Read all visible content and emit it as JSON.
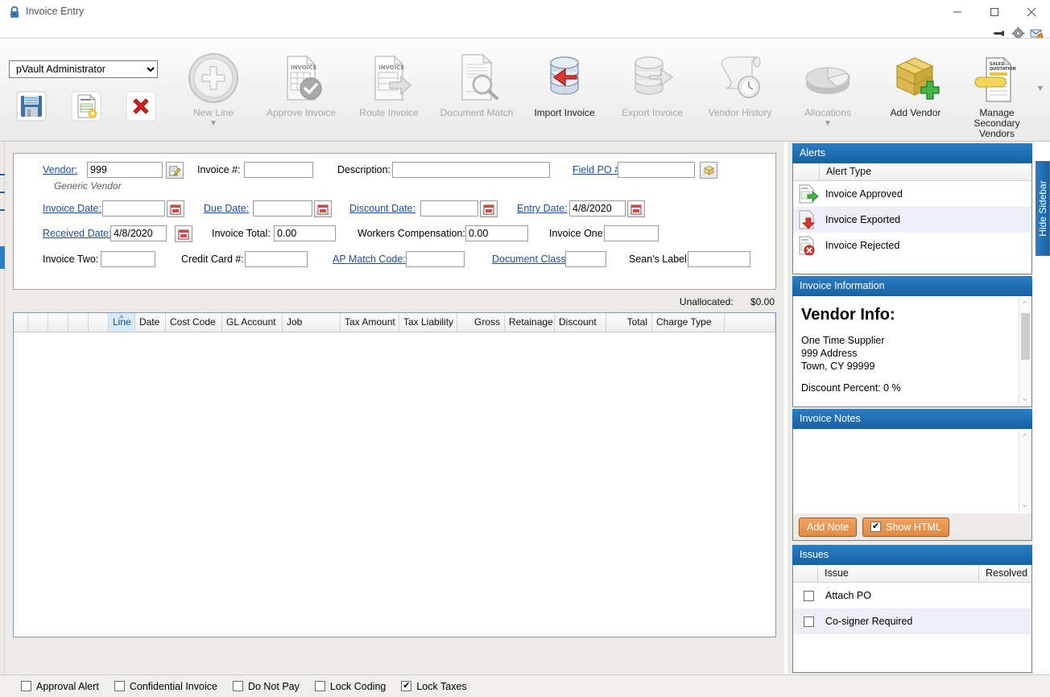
{
  "window": {
    "title": "Invoice Entry",
    "lock_icon": "lock-icon",
    "minimize": "–",
    "maximize": "□",
    "close": "✕",
    "header_icons": [
      "pin-icon",
      "gear-icon",
      "mail-alert-icon"
    ]
  },
  "ribbon": {
    "role_selected": "pVault Administrator",
    "role_options": [
      "pVault Administrator"
    ],
    "quick_buttons": [
      {
        "name": "save-button",
        "icon": "floppy-disk-icon"
      },
      {
        "name": "new-invoice-button",
        "icon": "new-invoice-icon"
      },
      {
        "name": "delete-button",
        "icon": "red-x-icon"
      }
    ],
    "buttons": [
      {
        "label": "New Line",
        "icon": "plus-circle-icon",
        "enabled": false,
        "caret": "▼"
      },
      {
        "label": "Approve Invoice",
        "icon": "invoice-check-icon",
        "enabled": false,
        "caret": ""
      },
      {
        "label": "Route Invoice",
        "icon": "invoice-arrow-icon",
        "enabled": false,
        "caret": ""
      },
      {
        "label": "Document Match",
        "icon": "document-magnifier-icon",
        "enabled": false,
        "caret": ""
      },
      {
        "label": "Import Invoice",
        "icon": "database-import-icon",
        "enabled": true,
        "caret": ""
      },
      {
        "label": "Export Invoice",
        "icon": "database-export-icon",
        "enabled": false,
        "caret": ""
      },
      {
        "label": "Vendor History",
        "icon": "scroll-clock-icon",
        "enabled": false,
        "caret": ""
      },
      {
        "label": "Allocations",
        "icon": "pie-chart-icon",
        "enabled": false,
        "caret": "▼"
      },
      {
        "label": "Add Vendor",
        "icon": "box-plus-icon",
        "enabled": true,
        "caret": ""
      },
      {
        "label": "Manage Secondary Vendors",
        "icon": "sales-quotation-icon",
        "enabled": true,
        "caret": ""
      }
    ],
    "scroll_caret": "▼"
  },
  "form": {
    "vendor_label": "Vendor:",
    "vendor_value": "999",
    "vendor_sub": "Generic Vendor",
    "vendor_picker_icon": "edit-note-icon",
    "invoice_number_label": "Invoice #:",
    "invoice_number_value": "",
    "description_label": "Description:",
    "description_value": "",
    "field_po_label": "Field PO #:",
    "field_po_value": "",
    "field_po_icon": "box-icon",
    "invoice_date_label": "Invoice Date:",
    "invoice_date_value": "",
    "due_date_label": "Due Date:",
    "due_date_value": "",
    "discount_date_label": "Discount Date:",
    "discount_date_value": "",
    "entry_date_label": "Entry Date:",
    "entry_date_value": "4/8/2020",
    "received_date_label": "Received Date:",
    "received_date_value": "4/8/2020",
    "invoice_total_label": "Invoice Total:",
    "invoice_total_value": "0.00",
    "workers_comp_label": "Workers Compensation:",
    "workers_comp_value": "0.00",
    "invoice_one_label": "Invoice One:",
    "invoice_one_value": "",
    "invoice_two_label": "Invoice Two:",
    "invoice_two_value": "",
    "credit_card_label": "Credit Card #:",
    "credit_card_value": "",
    "ap_match_label": "AP Match Code:",
    "ap_match_value": "",
    "document_class_label": "Document Class:",
    "document_class_value": "",
    "seans_label_label": "Sean's Label:",
    "seans_label_value": "",
    "calendar_icon": "calendar-icon"
  },
  "unallocated": {
    "label": "Unallocated:",
    "value": "$0.00"
  },
  "grid": {
    "columns": [
      "Line",
      "Date",
      "Cost Code",
      "GL Account",
      "Job",
      "Tax Amount",
      "Tax Liability",
      "Gross",
      "Retainage",
      "Discount",
      "Total",
      "Charge Type"
    ],
    "sorted_column": "Line",
    "sort_arrow": "▲",
    "rows": []
  },
  "sidebar": {
    "alerts": {
      "title": "Alerts",
      "column_header": "Alert Type",
      "items": [
        {
          "label": "Invoice Approved",
          "icon": "invoice-green-arrow-icon"
        },
        {
          "label": "Invoice Exported",
          "icon": "invoice-red-down-arrow-icon"
        },
        {
          "label": "Invoice Rejected",
          "icon": "invoice-red-x-icon"
        }
      ]
    },
    "invoice_information": {
      "title": "Invoice Information",
      "heading": "Vendor Info:",
      "lines": [
        "One Time Supplier",
        "999 Address",
        "Town, CY 99999"
      ],
      "discount": "Discount Percent: 0 %"
    },
    "invoice_notes": {
      "title": "Invoice Notes",
      "body": "",
      "add_note_label": "Add Note",
      "show_html_label": "Show HTML",
      "show_html_checked": true
    },
    "issues": {
      "title": "Issues",
      "columns": [
        "Issue",
        "Resolved"
      ],
      "rows": [
        {
          "label": "Attach PO",
          "resolved": false
        },
        {
          "label": "Co-signer Required",
          "resolved": false
        }
      ]
    },
    "hide_sidebar_label": "Hide Sidebar"
  },
  "status_bar": {
    "checkboxes": [
      {
        "label": "Approval Alert",
        "checked": false
      },
      {
        "label": "Confidential Invoice",
        "checked": false
      },
      {
        "label": "Do Not Pay",
        "checked": false
      },
      {
        "label": "Lock Coding",
        "checked": false
      },
      {
        "label": "Lock Taxes",
        "checked": true
      }
    ]
  },
  "colors": {
    "accent": "#1761a4",
    "orange": "#e08c45",
    "link": "#1b4f9c"
  }
}
